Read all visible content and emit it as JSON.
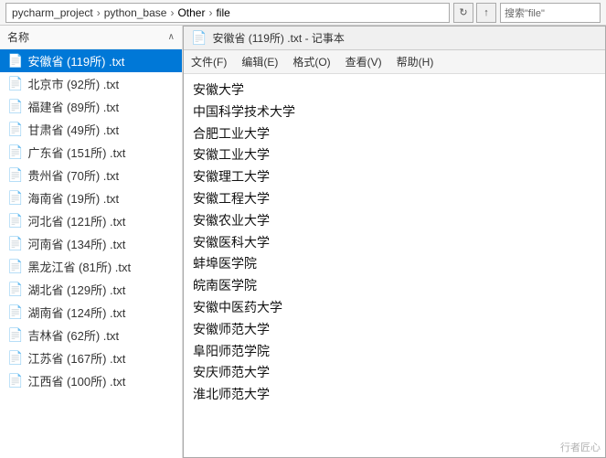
{
  "addressBar": {
    "path": [
      "pycharm_project",
      "python_base",
      "Other",
      "file"
    ],
    "searchLabel": "搜索\"file\"",
    "refreshIcon": "↻",
    "upIcon": "↑"
  },
  "filePanel": {
    "headerLabel": "名称",
    "sortArrow": "∧",
    "files": [
      {
        "name": "安徽省 (119所) .txt",
        "selected": true
      },
      {
        "name": "北京市 (92所) .txt",
        "selected": false
      },
      {
        "name": "福建省 (89所) .txt",
        "selected": false
      },
      {
        "name": "甘肃省 (49所) .txt",
        "selected": false
      },
      {
        "name": "广东省 (151所) .txt",
        "selected": false
      },
      {
        "name": "贵州省 (70所) .txt",
        "selected": false
      },
      {
        "name": "海南省 (19所) .txt",
        "selected": false
      },
      {
        "name": "河北省 (121所) .txt",
        "selected": false
      },
      {
        "name": "河南省 (134所) .txt",
        "selected": false
      },
      {
        "name": "黑龙江省 (81所) .txt",
        "selected": false
      },
      {
        "name": "湖北省 (129所) .txt",
        "selected": false
      },
      {
        "name": "湖南省 (124所) .txt",
        "selected": false
      },
      {
        "name": "吉林省 (62所) .txt",
        "selected": false
      },
      {
        "name": "江苏省 (167所) .txt",
        "selected": false
      },
      {
        "name": "江西省 (100所) .txt",
        "selected": false
      }
    ]
  },
  "notepad": {
    "titleIcon": "📄",
    "title": "安徽省 (119所) .txt - 记事本",
    "menuItems": [
      "文件(F)",
      "编辑(E)",
      "格式(O)",
      "查看(V)",
      "帮助(H)"
    ],
    "lines": [
      "安徽大学",
      "中国科学技术大学",
      "合肥工业大学",
      "安徽工业大学",
      "安徽理工大学",
      "安徽工程大学",
      "安徽农业大学",
      "安徽医科大学",
      "蚌埠医学院",
      "皖南医学院",
      "安徽中医药大学",
      "安徽师范大学",
      "阜阳师范学院",
      "安庆师范大学",
      "淮北师范大学"
    ]
  },
  "watermark": "行者匠心"
}
